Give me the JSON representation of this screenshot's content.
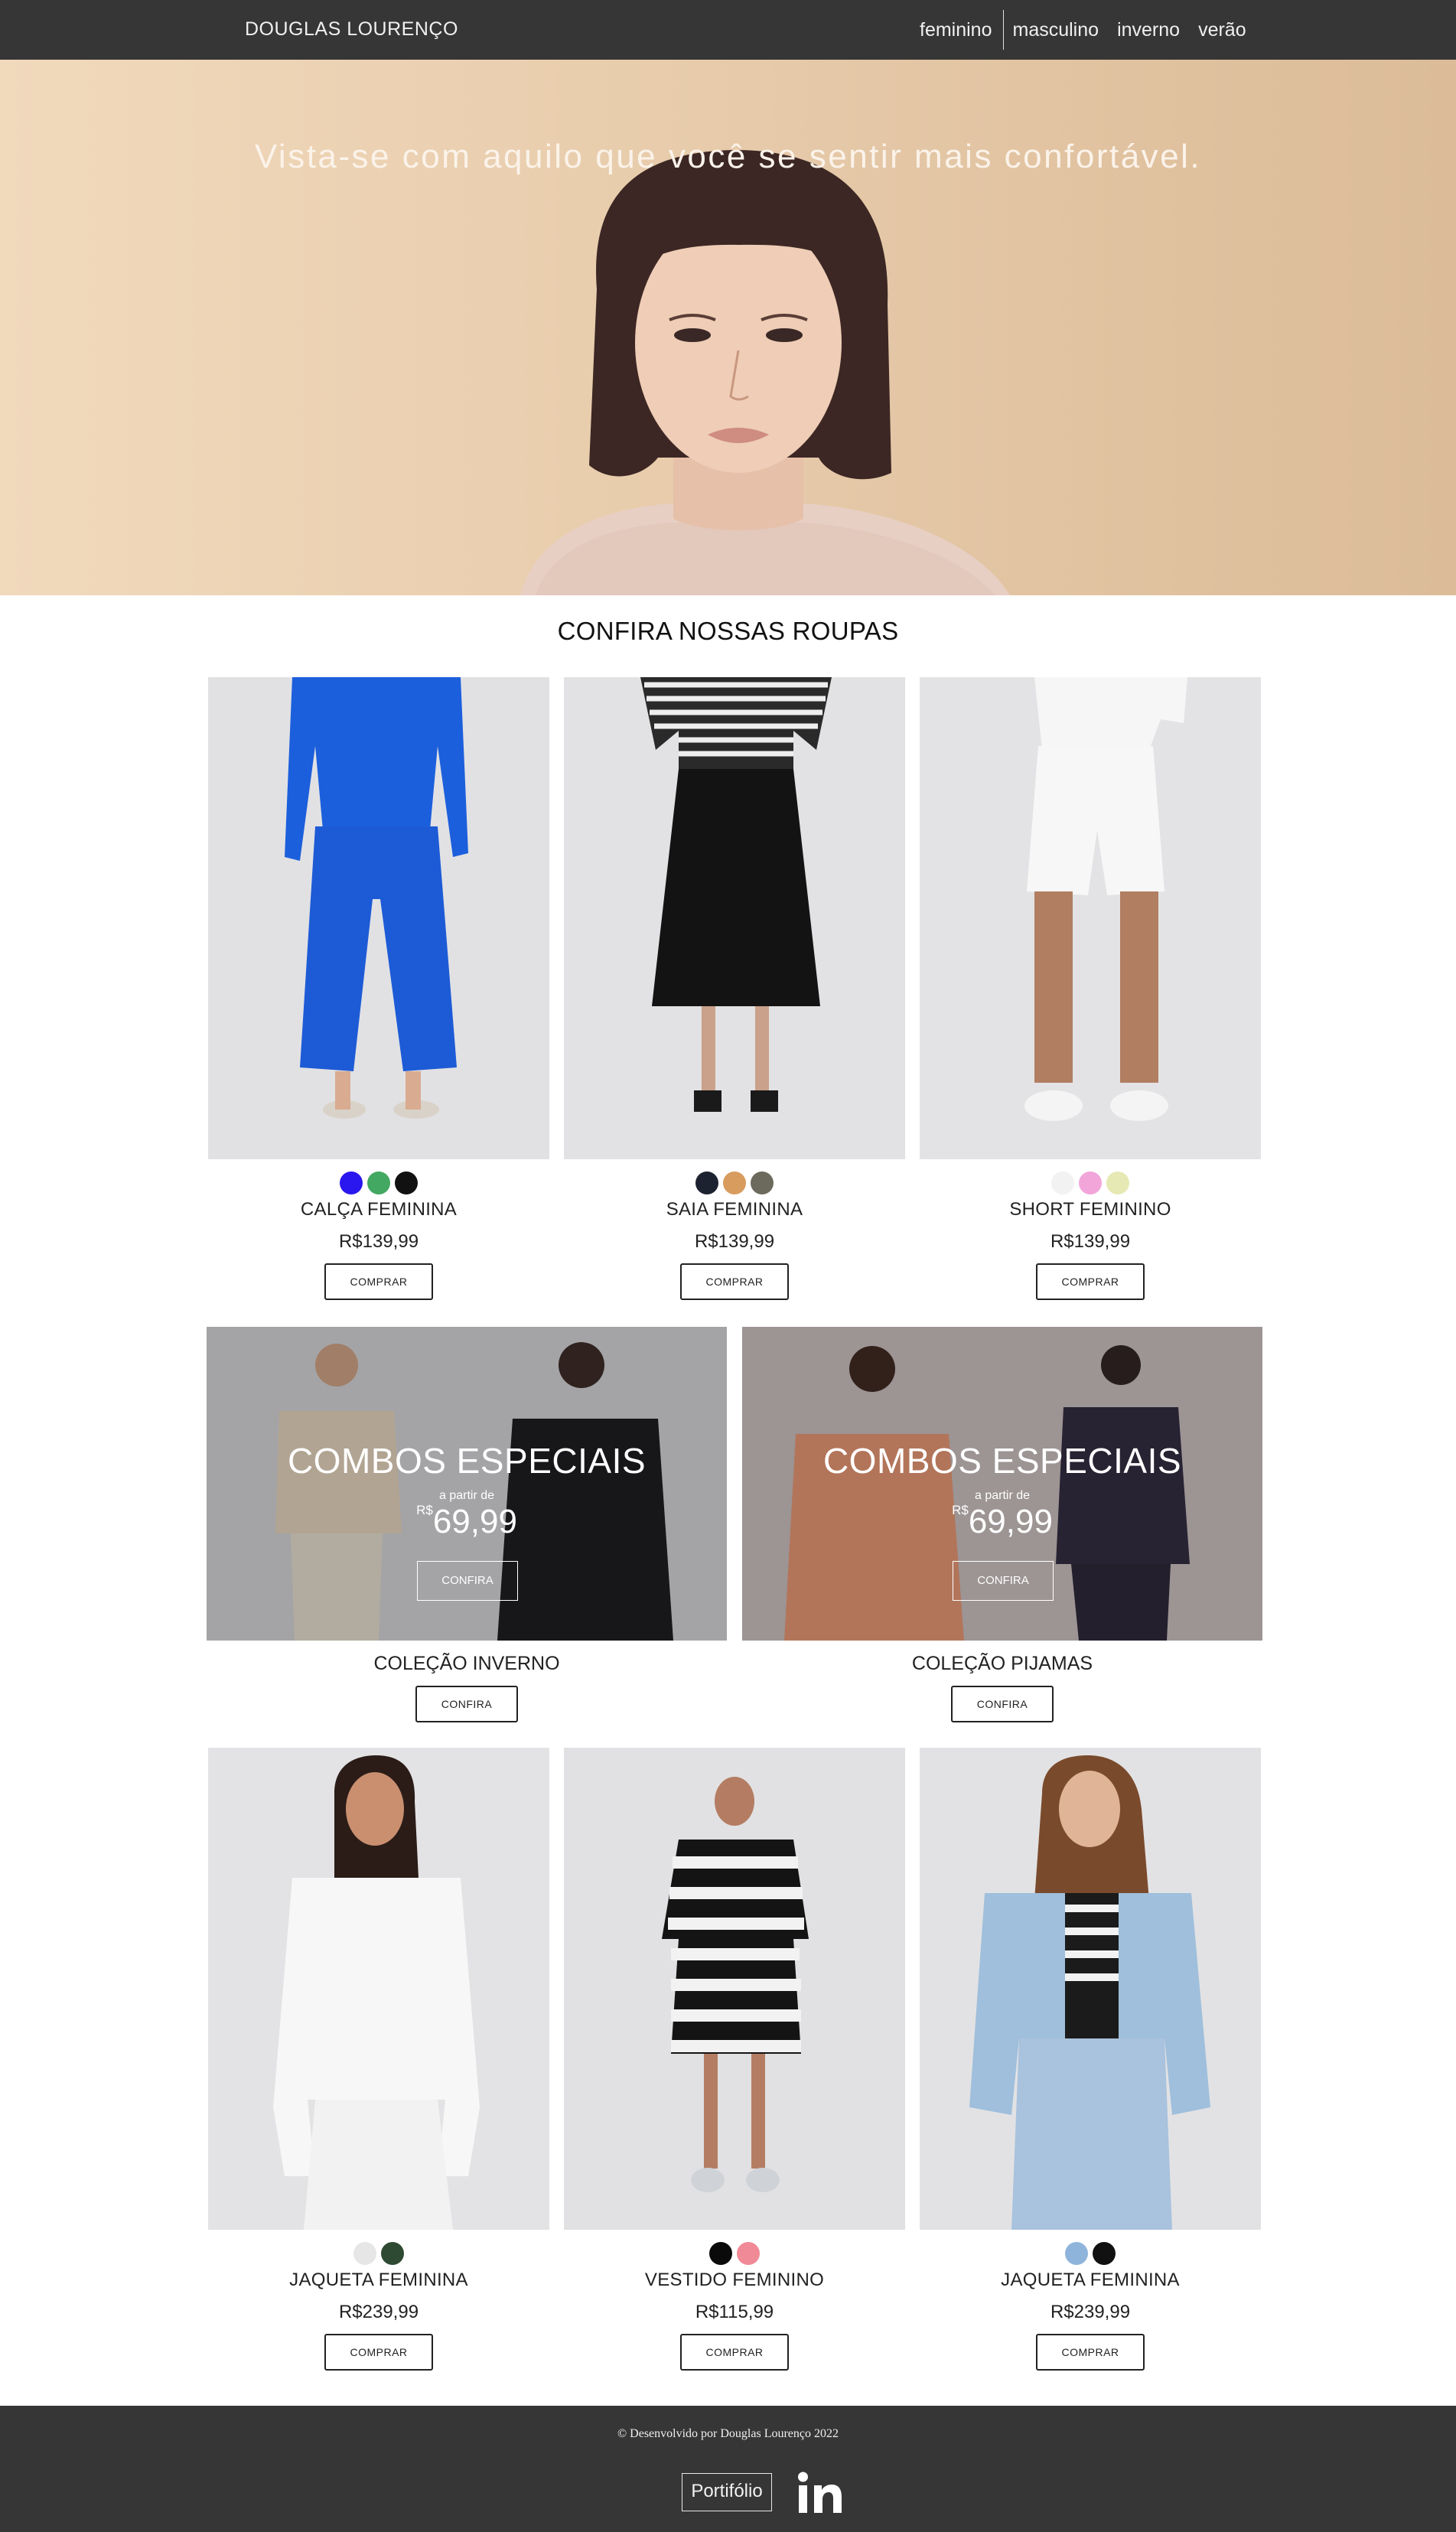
{
  "nav": {
    "brand": "DOUGLAS LOURENÇO",
    "links": [
      "feminino",
      "masculino",
      "inverno",
      "verão"
    ]
  },
  "hero": {
    "headline": "Vista-se com aquilo que você se sentir mais confortável."
  },
  "section_title": "CONFIRA NOSSAS ROUPAS",
  "products_top": [
    {
      "name": "CALÇA FEMININA",
      "price": "R$139,99",
      "button": "COMPRAR",
      "swatches": [
        "#2a16ee",
        "#43a861",
        "#111111"
      ]
    },
    {
      "name": "SAIA FEMININA",
      "price": "R$139,99",
      "button": "COMPRAR",
      "swatches": [
        "#1d2230",
        "#d89c5e",
        "#6c6a5c"
      ]
    },
    {
      "name": "SHORT FEMININO",
      "price": "R$139,99",
      "button": "COMPRAR",
      "swatches": [
        "#f2f2f2",
        "#f2a5d9",
        "#e7e9b4"
      ]
    }
  ],
  "banners": [
    {
      "title": "COMBOS ESPECIAIS",
      "from": "a partir de",
      "currency": "R$",
      "price": "69,99",
      "overlay_button": "CONFIRA",
      "collection": "COLEÇÃO INVERNO",
      "button": "CONFIRA"
    },
    {
      "title": "COMBOS ESPECIAIS",
      "from": "a partir de",
      "currency": "R$",
      "price": "69,99",
      "overlay_button": "CONFIRA",
      "collection": "COLEÇÃO PIJAMAS",
      "button": "CONFIRA"
    }
  ],
  "products_bottom": [
    {
      "name": "JAQUETA FEMININA",
      "price": "R$239,99",
      "button": "COMPRAR",
      "swatches": [
        "#e6e6e6",
        "#2f4a32"
      ]
    },
    {
      "name": "VESTIDO FEMININO",
      "price": "R$115,99",
      "button": "COMPRAR",
      "swatches": [
        "#0a0a0a",
        "#f08a96"
      ]
    },
    {
      "name": "JAQUETA FEMININA",
      "price": "R$239,99",
      "button": "COMPRAR",
      "swatches": [
        "#8fb4dc",
        "#111111"
      ]
    }
  ],
  "footer": {
    "credit": "© Desenvolvido por Douglas Lourenço 2022",
    "portfolio": "Portifólio",
    "linkedin_icon": "linkedin-icon"
  },
  "colors": {
    "nav_bg": "#363636",
    "footer_bg": "#363636",
    "hero_bg": "#e9ceae"
  }
}
